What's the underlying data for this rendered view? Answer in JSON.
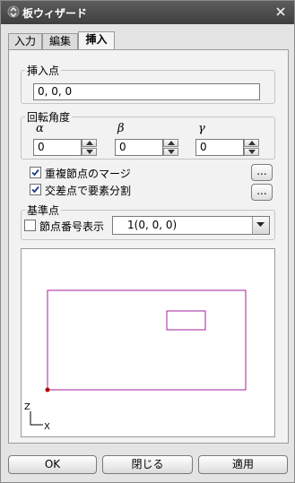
{
  "window": {
    "title": "板ウィザード"
  },
  "tabs": [
    {
      "label": "入力",
      "active": false
    },
    {
      "label": "編集",
      "active": false
    },
    {
      "label": "挿入",
      "active": true
    }
  ],
  "insert_point": {
    "label": "挿入点",
    "value": "0, 0, 0"
  },
  "rotation": {
    "label": "回転角度",
    "alpha": {
      "symbol": "α",
      "value": "0"
    },
    "beta": {
      "symbol": "β",
      "value": "0"
    },
    "gamma": {
      "symbol": "γ",
      "value": "0"
    }
  },
  "options": {
    "merge_duplicate": {
      "label": "重複節点のマージ",
      "checked": true,
      "button_label": "..."
    },
    "split_at_intersection": {
      "label": "交差点で要素分割",
      "checked": true,
      "button_label": "..."
    }
  },
  "base_point": {
    "label": "基準点",
    "show_node_number": {
      "label": "節点番号表示",
      "checked": false
    },
    "selected": "1(0, 0, 0)"
  },
  "preview": {
    "axis_vertical": "Z",
    "axis_horizontal": "X",
    "outline_color": "#a020a0",
    "point_color": "#b00000"
  },
  "buttons": {
    "ok": "OK",
    "close": "閉じる",
    "apply": "適用"
  }
}
